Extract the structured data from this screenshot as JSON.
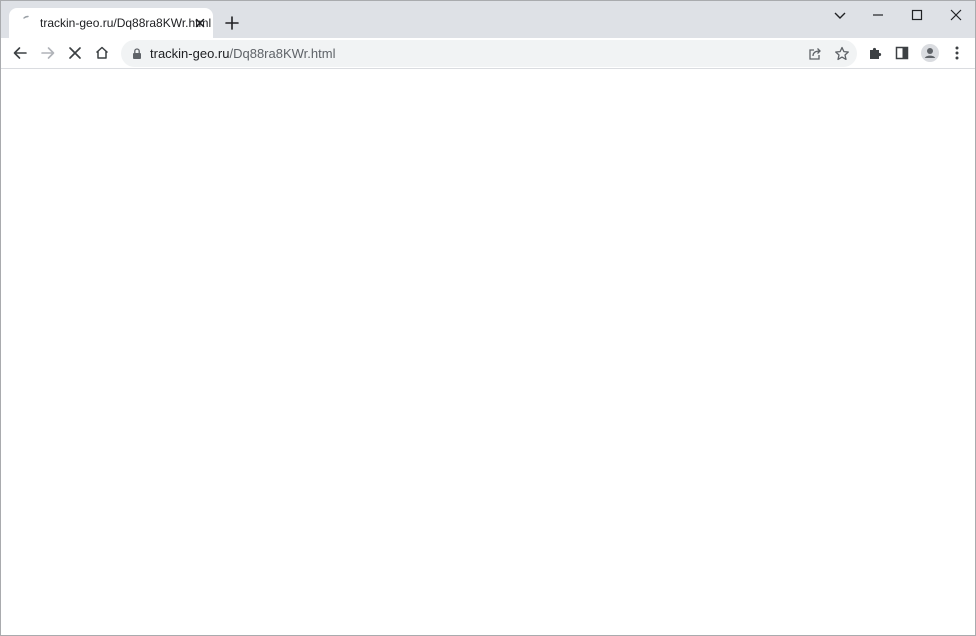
{
  "tab": {
    "title": "trackin-geo.ru/Dq88ra8KWr.html"
  },
  "omnibox": {
    "host": "trackin-geo.ru",
    "path": "/Dq88ra8KWr.html"
  },
  "icons": {
    "favicon": "loading-spinner-icon",
    "tab_close": "close-icon",
    "new_tab": "plus-icon",
    "tab_search": "chevron-down-icon",
    "minimize": "minimize-icon",
    "maximize": "maximize-icon",
    "close_window": "close-icon",
    "back": "back-arrow-icon",
    "forward": "forward-arrow-icon",
    "stop": "stop-icon",
    "home": "home-icon",
    "lock": "lock-icon",
    "share": "share-icon",
    "bookmark": "star-icon",
    "extensions": "puzzle-icon",
    "side_panel": "side-panel-icon",
    "profile": "profile-icon",
    "menu": "kebab-menu-icon"
  },
  "colors": {
    "tabstrip": "#dee1e6",
    "omnibox": "#f1f3f4",
    "icon": "#5f6368",
    "text": "#202124"
  }
}
